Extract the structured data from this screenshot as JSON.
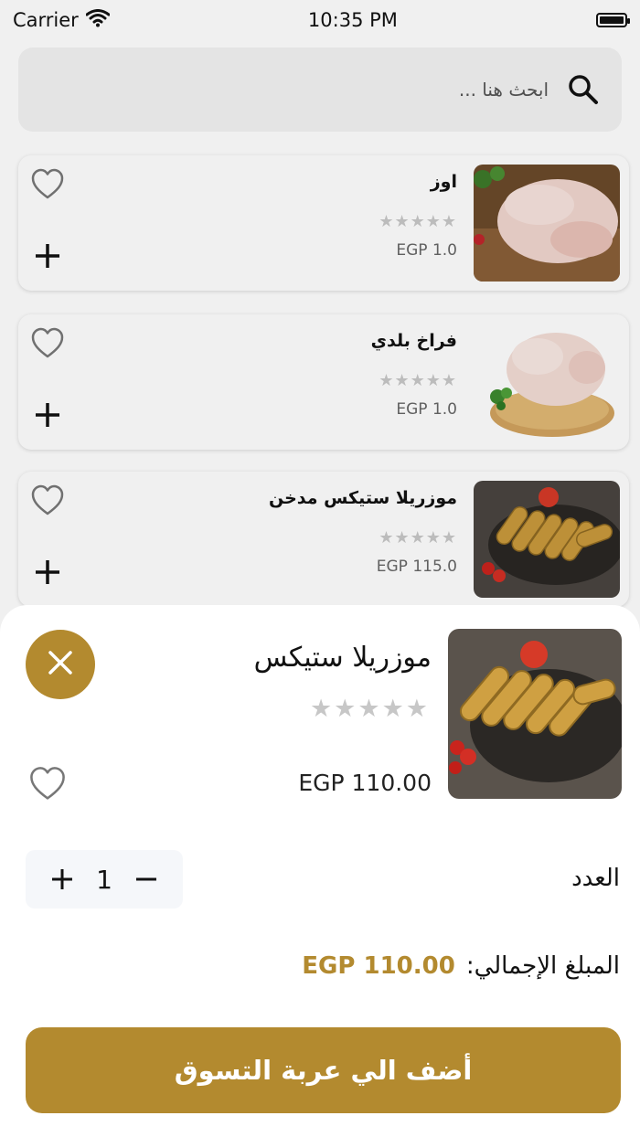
{
  "status_bar": {
    "carrier": "Carrier",
    "time": "10:35 PM"
  },
  "search": {
    "placeholder": "ابحث هنا ..."
  },
  "products": [
    {
      "name": "اوز",
      "rating": 0,
      "stars": "★★★★★",
      "price": "EGP 1.0"
    },
    {
      "name": "فراخ بلدي",
      "rating": 0,
      "stars": "★★★★★",
      "price": "EGP 1.0"
    },
    {
      "name": "موزريلا ستيكس مدخن",
      "rating": 0,
      "stars": "★★★★★",
      "price": "EGP 115.0"
    }
  ],
  "sheet": {
    "name": "موزريلا ستيكس",
    "rating": 0,
    "stars": "★★★★★",
    "price": "EGP 110.00",
    "quantity_label": "العدد",
    "quantity": "1",
    "total_label": "المبلغ الإجمالي:",
    "total_value": "EGP 110.00",
    "add_to_cart_label": "أضف الي عربة التسوق"
  },
  "colors": {
    "accent": "#b38a2f",
    "search_bg": "#f3f3f3",
    "stepper_bg": "#f5f7fa"
  },
  "icons": [
    "wifi-icon",
    "battery-icon",
    "search-icon",
    "heart-icon",
    "plus-icon",
    "close-icon",
    "minus-icon"
  ]
}
